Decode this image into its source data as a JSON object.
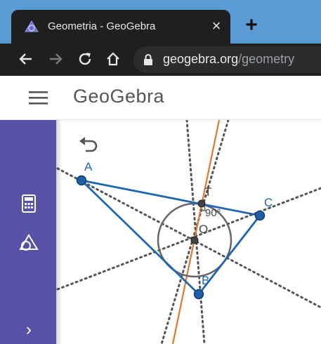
{
  "browser": {
    "tab_title": "Geometria - GeoGebra",
    "tab_close": "×",
    "new_tab": "+",
    "url_domain": "geogebra.org",
    "url_path": "/geometry"
  },
  "app": {
    "logo_text": "GeoGebra",
    "brand_color": "#5751a8"
  },
  "rail": {
    "items": [
      {
        "icon": "calculator-icon"
      },
      {
        "icon": "geometry-tools-icon"
      }
    ],
    "expand_label": "›"
  },
  "construction": {
    "points": [
      "A",
      "B",
      "C",
      "T",
      "O"
    ],
    "angle_label": "90°",
    "colors": {
      "triangle": "#2166b0",
      "point_fill": "#1e5fa8",
      "tangent_line": "#e0782e",
      "circle": "#666666",
      "dotted_lines": "#555555"
    }
  }
}
